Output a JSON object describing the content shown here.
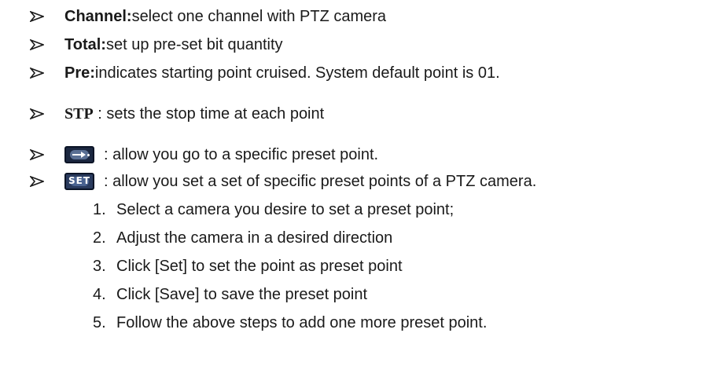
{
  "bullets": [
    {
      "term": "Channel:",
      "text": " select one channel with PTZ camera"
    },
    {
      "term": "Total:",
      "text": " set up pre-set bit quantity"
    },
    {
      "term": "Pre:",
      "text": " indicates starting point cruised. System default point is 01."
    },
    {
      "term": "STP",
      "text": " : sets the stop time at each point"
    },
    {
      "icon": "goto-preset-button-icon",
      "text": ": allow you go to a specific preset point."
    },
    {
      "icon": "set-preset-button-icon",
      "icon_label": "SET",
      "text": ": allow you set a set of specific preset points of a PTZ camera."
    }
  ],
  "steps": [
    {
      "num": "1.",
      "text": "Select a camera you desire to set a preset point;"
    },
    {
      "num": "2.",
      "text": "Adjust the camera in a desired direction"
    },
    {
      "num": "3.",
      "text": "Click [Set] to set the point as preset point"
    },
    {
      "num": "4.",
      "text": "Click [Save] to save the preset point"
    },
    {
      "num": "5.",
      "text": "Follow the above steps to add one more preset point."
    }
  ],
  "colors": {
    "icon_bg": "#1b2740",
    "text": "#1a1a1a"
  }
}
